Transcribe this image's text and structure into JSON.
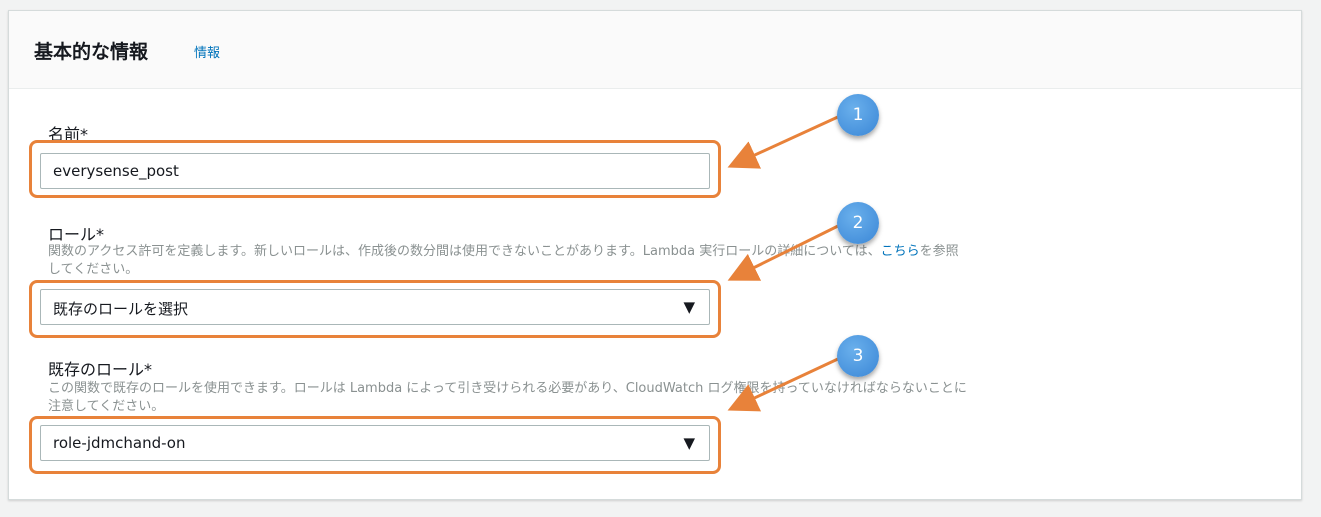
{
  "panel": {
    "title": "基本的な情報",
    "info_link": "情報"
  },
  "name_field": {
    "label": "名前*",
    "value": "everysense_post"
  },
  "role_field": {
    "label": "ロール*",
    "description_prefix": "関数のアクセス許可を定義します。新しいロールは、作成後の数分間は使用できないことがあります。Lambda 実行ロールの詳細については、",
    "description_link": "こちら",
    "description_suffix": "を参照してください。",
    "selected": "既存のロールを選択"
  },
  "existing_role_field": {
    "label": "既存のロール*",
    "description": "この関数で既存のロールを使用できます。ロールは Lambda によって引き受けられる必要があり、CloudWatch ログ権限を持っていなければならないことに注意してください。",
    "selected": "role-jdmchand-on"
  },
  "callouts": [
    "1",
    "2",
    "3"
  ],
  "colors": {
    "highlight": "#e8823a",
    "badge": "#3a86d6",
    "link": "#0073bb"
  },
  "icons": {
    "dropdown": "caret-down-icon"
  }
}
